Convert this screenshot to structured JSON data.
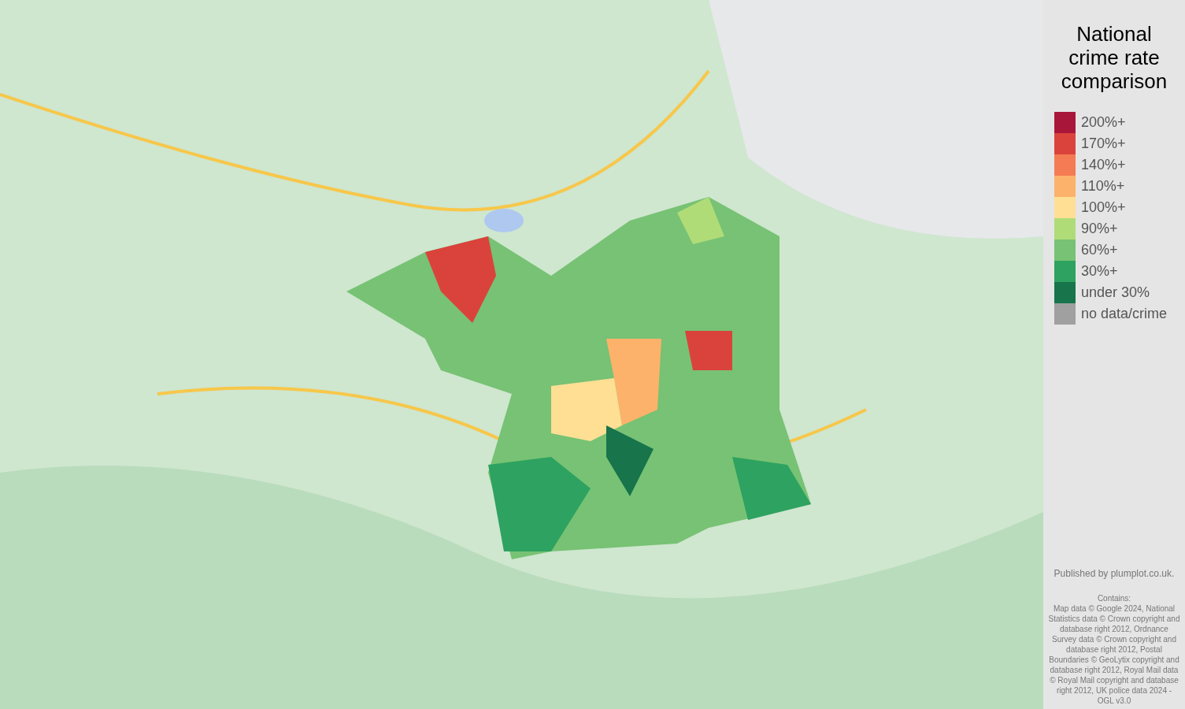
{
  "legend": {
    "title": "National crime rate comparison",
    "items": [
      {
        "label": "200%+",
        "color": "#a8173a"
      },
      {
        "label": "170%+",
        "color": "#da433c"
      },
      {
        "label": "140%+",
        "color": "#f47b53"
      },
      {
        "label": "110%+",
        "color": "#fcb26a"
      },
      {
        "label": "100%+",
        "color": "#fedf93"
      },
      {
        "label": "90%+",
        "color": "#b0dc78"
      },
      {
        "label": "60%+",
        "color": "#77c274"
      },
      {
        "label": "30%+",
        "color": "#2ea260"
      },
      {
        "label": "under 30%",
        "color": "#17744b"
      },
      {
        "label": "no data/crime",
        "color": "#a0a0a0"
      }
    ]
  },
  "publisher": "Published by plumplot.co.uk.",
  "attribution": {
    "heading": "Contains:",
    "text": "Map data © Google 2024, National Statistics data © Crown copyright and database right 2012, Ordnance Survey data © Crown copyright and database right 2012, Postal Boundaries © GeoLytix copyright and database right 2012, Royal Mail data © Royal Mail copyright and database right 2012, UK police data 2024 - OGL v3.0"
  }
}
